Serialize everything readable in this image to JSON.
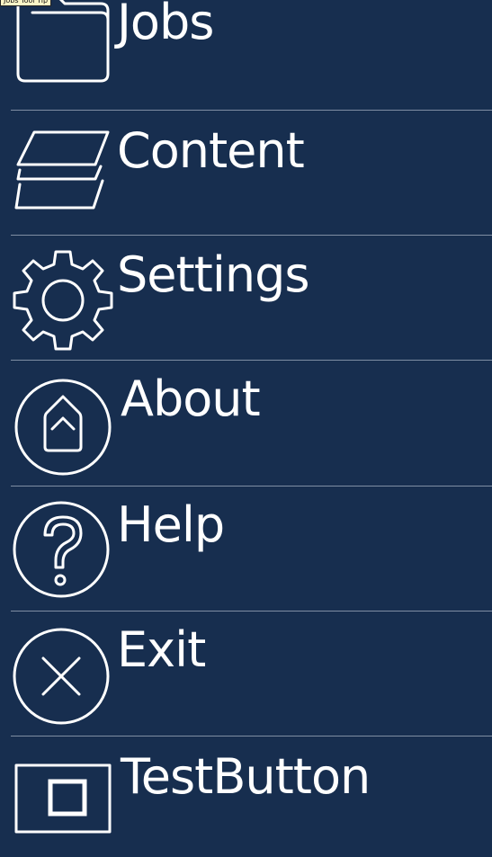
{
  "colors": {
    "background": "#172e4f",
    "text": "#ffffff",
    "divider": "#7f8ea3"
  },
  "tooltip": {
    "text": "Jobs Tool Tip"
  },
  "menu": {
    "items": [
      {
        "label": "Jobs",
        "icon": "folder-icon"
      },
      {
        "label": "Content",
        "icon": "layers-icon"
      },
      {
        "label": "Settings",
        "icon": "gear-icon"
      },
      {
        "label": "About",
        "icon": "info-house-icon"
      },
      {
        "label": "Help",
        "icon": "question-icon"
      },
      {
        "label": "Exit",
        "icon": "close-icon"
      },
      {
        "label": "TestButton",
        "icon": "window-icon"
      }
    ]
  }
}
